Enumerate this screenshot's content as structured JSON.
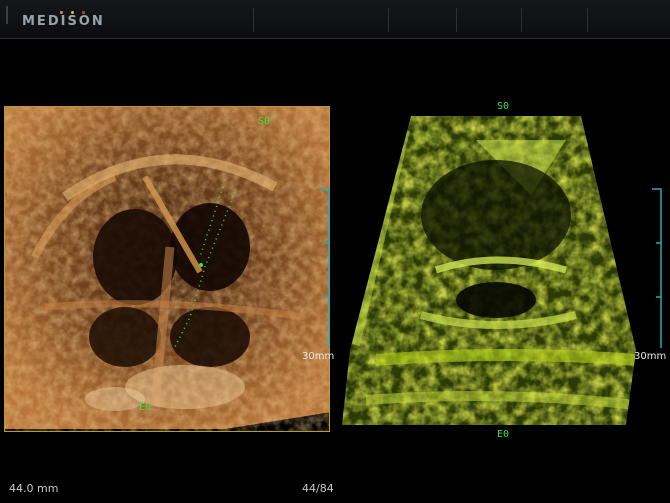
{
  "app": {
    "brand": "MEDISON",
    "brand_dot_colors": [
      "#e08a2c",
      "#d8c23a",
      "#d2412f"
    ]
  },
  "left_view": {
    "start_marker": "S0",
    "end_marker": "E0",
    "scale_label": "30mm",
    "frame_color": "#b59a3a"
  },
  "right_view": {
    "start_marker": "S0",
    "end_marker": "E0",
    "scale_label": "30mm"
  },
  "footer": {
    "depth": "44.0 mm",
    "frame_counter": "44/84"
  },
  "colors": {
    "scale_cyan": "#2aa7b4",
    "marker_green": "#3fe04a",
    "render_yellow_green": "#b6d21a",
    "render_copper": "#d38a3a"
  }
}
